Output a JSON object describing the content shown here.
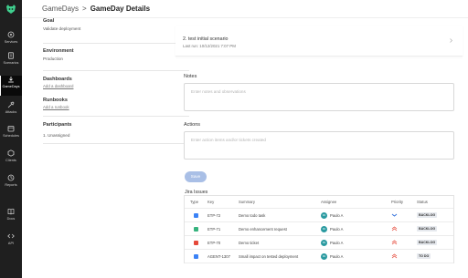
{
  "sidebar": {
    "items": [
      {
        "label": "Services",
        "icon": "services-icon",
        "active": false
      },
      {
        "label": "Scenarios",
        "icon": "scenarios-icon",
        "active": false
      },
      {
        "label": "GameDays",
        "icon": "gamedays-icon",
        "active": true
      },
      {
        "label": "Attacks",
        "icon": "attacks-icon",
        "active": false
      },
      {
        "label": "Schedules",
        "icon": "schedules-icon",
        "active": false
      },
      {
        "label": "Clients",
        "icon": "clients-icon",
        "active": false
      },
      {
        "label": "Reports",
        "icon": "reports-icon",
        "active": false
      },
      {
        "label": "Docs",
        "icon": "docs-icon",
        "active": false
      },
      {
        "label": "API",
        "icon": "api-icon",
        "active": false
      }
    ]
  },
  "header": {
    "crumb_parent": "GameDays",
    "crumb_sep": ">",
    "crumb_current": "GameDay Details"
  },
  "left_panel": {
    "goal_title": "Goal",
    "goal_value": "Validate deployment",
    "environment_title": "Environment",
    "environment_value": "Production",
    "dashboards_title": "Dashboards",
    "dashboards_link": "Add a dashboard",
    "runbooks_title": "Runbooks",
    "runbooks_link": "Add a runbook",
    "participants_title": "Participants",
    "participants_value": "1. Unassigned"
  },
  "scenario": {
    "title": "2. test initial scenario",
    "last_run": "Last run: 10/12/2021 7:07 PM"
  },
  "notes": {
    "label": "Notes",
    "placeholder": "Enter notes and observations"
  },
  "actions": {
    "label": "Actions",
    "placeholder": "Enter action items and/or tickets created"
  },
  "save_label": "Save",
  "jira": {
    "title": "Jira Issues",
    "columns": [
      "Type",
      "Key",
      "Summary",
      "Assignee",
      "Priority",
      "Status"
    ],
    "rows": [
      {
        "type_color": "#3b82f6",
        "key": "ETP-72",
        "summary": "Demo todo task",
        "assignee_initials": "PA",
        "assignee": "Paulo A",
        "priority": "low",
        "status": "BACKLOG"
      },
      {
        "type_color": "#36b37e",
        "key": "ETP-71",
        "summary": "Demo enhancement request",
        "assignee_initials": "PA",
        "assignee": "Paulo A",
        "priority": "high",
        "status": "BACKLOG"
      },
      {
        "type_color": "#e5493a",
        "key": "ETP-70",
        "summary": "Demo ticket",
        "assignee_initials": "PA",
        "assignee": "Paulo A",
        "priority": "high",
        "status": "BACKLOG"
      },
      {
        "type_color": "#3b82f6",
        "key": "AGENT-1307",
        "summary": "Small impact on tested deployment",
        "assignee_initials": "PA",
        "assignee": "Paulo A",
        "priority": "high",
        "status": "TO DO"
      }
    ]
  },
  "colors": {
    "sidebar_bg": "#1f1f1f",
    "accent": "#a9bfe6",
    "priority_high": "#e5493a",
    "priority_low": "#2f6fdb"
  }
}
